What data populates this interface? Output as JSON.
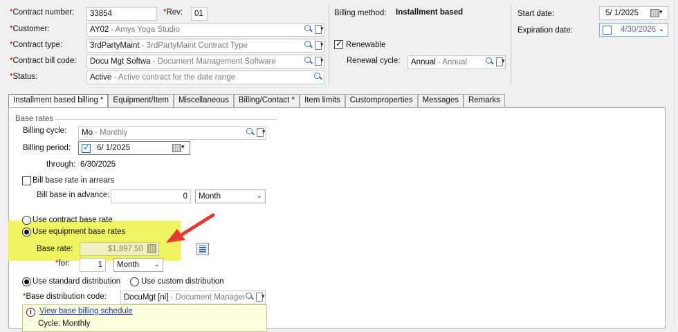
{
  "header": {
    "contract_number_label": "Contract number:",
    "contract_number": "33854",
    "rev_label": "Rev:",
    "rev": "01",
    "customer_label": "Customer:",
    "customer_code": "AY02",
    "customer_desc": "- Amys Yoga Studio",
    "contract_type_label": "Contract type:",
    "contract_type_code": "3rdPartyMaint",
    "contract_type_desc": "- 3rdPartyMaint Contract Type",
    "bill_code_label": "Contract bill code:",
    "bill_code": "Docu Mgt Softwa",
    "bill_code_desc": "- Document Management Software",
    "status_label": "Status:",
    "status_value": "Active",
    "status_desc": "- Active contract for the date range",
    "billing_method_label": "Billing method:",
    "billing_method_value": "Installment based",
    "renewable_label": "Renewable",
    "renewal_cycle_label": "Renewal cycle:",
    "renewal_cycle_code": "Annual",
    "renewal_cycle_desc": "- Annual",
    "start_date_label": "Start date:",
    "start_date": "5/  1/2025",
    "expiration_date_label": "Expiration date:",
    "expiration_date": "4/30/2026"
  },
  "tabs": [
    "Installment based billing *",
    "Equipment/Item",
    "Miscellaneous",
    "Billing/Contact *",
    "Item limits",
    "Customproperties",
    "Messages",
    "Remarks"
  ],
  "billing": {
    "base_rates_label": "Base rates",
    "billing_cycle_label": "Billing cycle:",
    "billing_cycle_code": "Mo",
    "billing_cycle_desc": "- Monthly",
    "billing_period_label": "Billing period:",
    "billing_period": "6/  1/2025",
    "through_label": "through:",
    "through_value": "6/30/2025",
    "arrears_label": "Bill base rate in arrears",
    "advance_label": "Bill base in advance:",
    "advance_value": "0",
    "advance_unit": "Month",
    "use_contract_rate_label": "Use contract base rate",
    "use_equipment_rate_label": "Use equipment base rates",
    "base_rate_label": "Base rate:",
    "base_rate_value": "$1,897.50",
    "for_label": "for:",
    "for_value": "1",
    "for_unit": "Month",
    "standard_dist_label": "Use standard distribution",
    "custom_dist_label": "Use custom distribution",
    "dist_code_label": "Base distribution code:",
    "dist_code": "DocuMgt [ni]",
    "dist_desc": "- Document Management",
    "view_schedule_link": "View base billing schedule",
    "cycle_note": "Cycle: Monthly"
  },
  "colors": {
    "highlight": "#eef35a",
    "arrow": "#e53935",
    "required": "#c00000",
    "link": "#1a3fa8"
  }
}
